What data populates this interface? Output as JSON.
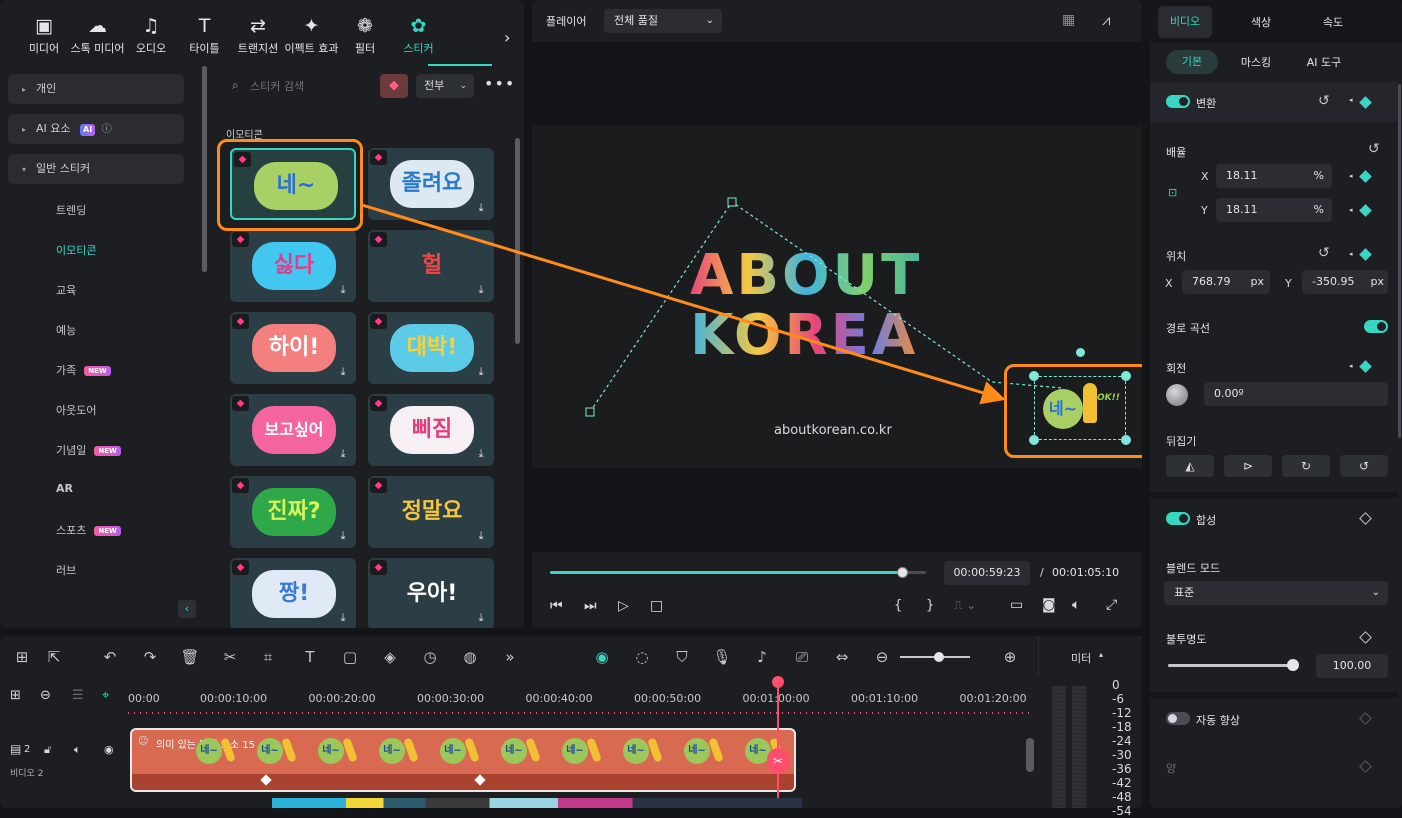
{
  "categories": [
    {
      "label": "미디어",
      "icon": "▣",
      "name": "media"
    },
    {
      "label": "스톡 미디어",
      "icon": "☁",
      "name": "stock-media"
    },
    {
      "label": "오디오",
      "icon": "♫",
      "name": "audio"
    },
    {
      "label": "타이틀",
      "icon": "T",
      "name": "titles"
    },
    {
      "label": "트랜지션",
      "icon": "⇄",
      "name": "transitions"
    },
    {
      "label": "이펙트 효과",
      "icon": "✦",
      "name": "effects"
    },
    {
      "label": "필터",
      "icon": "❁",
      "name": "filters"
    },
    {
      "label": "스티커",
      "icon": "✿",
      "name": "stickers"
    }
  ],
  "sidebar": {
    "personal": "개인",
    "ai": "AI 요소",
    "ai_badge": "AI",
    "general": "일반 스티커",
    "items": [
      {
        "label": "트렌딩",
        "new": false
      },
      {
        "label": "이모티콘",
        "new": false
      },
      {
        "label": "교육",
        "new": false
      },
      {
        "label": "예능",
        "new": false
      },
      {
        "label": "가족",
        "new": true
      },
      {
        "label": "아웃도어",
        "new": false
      },
      {
        "label": "기념일",
        "new": true
      },
      {
        "label": "AR",
        "new": false
      },
      {
        "label": "스포츠",
        "new": true
      },
      {
        "label": "러브",
        "new": false
      }
    ],
    "new_badge": "NEW"
  },
  "search": {
    "placeholder": "스티커 검색",
    "filter": "전부"
  },
  "section_title": "이모티콘",
  "stickers": [
    {
      "text": "네~",
      "color": "#a8d065",
      "fg": "#2a6fd6"
    },
    {
      "text": "졸려요",
      "color": "#dde9f2",
      "fg": "#2a7ac8"
    },
    {
      "text": "싫다",
      "color": "#42c8f0",
      "fg": "#e83a8a"
    },
    {
      "text": "헐",
      "color": "#2c3e45",
      "fg": "#f04848"
    },
    {
      "text": "하이!",
      "color": "#f37f7f",
      "fg": "#ffffff"
    },
    {
      "text": "대박!",
      "color": "#5ccbe8",
      "fg": "#f6d13a"
    },
    {
      "text": "보고싶어",
      "color": "#f465a0",
      "fg": "#ffffff"
    },
    {
      "text": "삐짐",
      "color": "#f6f0f4",
      "fg": "#e63a7a"
    },
    {
      "text": "진짜?",
      "color": "#2fa84a",
      "fg": "#d7f55a"
    },
    {
      "text": "정말요",
      "color": "#2c3e45",
      "fg": "#f6c63a"
    },
    {
      "text": "짱!",
      "color": "#dfeaf6",
      "fg": "#3a7ad6"
    },
    {
      "text": "우아!",
      "color": "#2c3e45",
      "fg": "#ffffff"
    }
  ],
  "player": {
    "label": "플레이어",
    "quality": "전체 품질",
    "current_time": "00:00:59:23",
    "total_time": "00:01:05:10",
    "time_sep": "/",
    "progress": 0.94
  },
  "preview": {
    "title_line1": "ABOUT",
    "title_line2": "KOREA",
    "url": "aboutkorean.co.kr",
    "sticker_text": "네~",
    "sticker_ok": "OK!!"
  },
  "props": {
    "tabs": [
      "비디오",
      "색상",
      "속도"
    ],
    "subtabs": [
      "기본",
      "마스킹",
      "AI 도구"
    ],
    "transform": "변환",
    "scale": "배율",
    "x_label": "X",
    "y_label": "Y",
    "scale_x": "18.11",
    "scale_y": "18.11",
    "pct": "%",
    "position": "위치",
    "pos_x": "768.79",
    "pos_y": "-350.95",
    "px": "px",
    "path_curve": "경로 곡선",
    "rotation": "회전",
    "rotation_value": "0.00º",
    "flip": "뒤집기",
    "composite": "합성",
    "blend_mode": "블렌드 모드",
    "blend_value": "표준",
    "opacity": "불투명도",
    "opacity_value": "100.00",
    "auto_enhance": "자동 향상",
    "amount": "양"
  },
  "timeline": {
    "ruler": [
      "00:00",
      "00:00:10:00",
      "00:00:20:00",
      "00:00:30:00",
      "00:00:40:00",
      "00:00:50:00",
      "00:01:00:00",
      "00:01:10:00",
      "00:01:20:00"
    ],
    "track_label": "비디오 2",
    "track_num": "2",
    "clip_title": "의미 있는 단어 요소 15",
    "meter_label": "미터",
    "meter_scale": [
      "0",
      "-6",
      "-12",
      "-18",
      "-24",
      "-30",
      "-36",
      "-42",
      "-48",
      "-54"
    ]
  },
  "colors": {
    "accent": "#36d6c3",
    "highlight": "#ff8c1a",
    "clip": "#d96a52"
  }
}
